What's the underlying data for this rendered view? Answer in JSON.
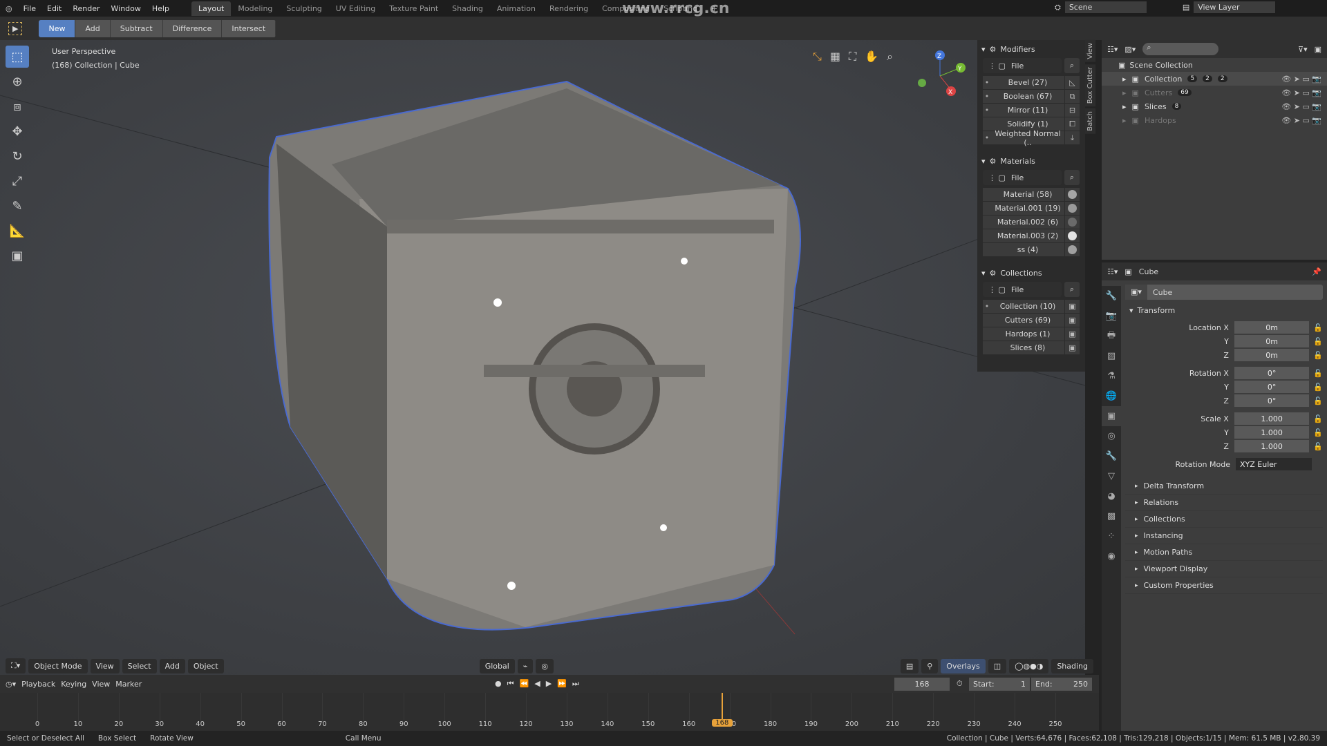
{
  "topbar": {
    "menus": [
      "File",
      "Edit",
      "Render",
      "Window",
      "Help"
    ],
    "workspaces": [
      "Layout",
      "Modeling",
      "Sculpting",
      "UV Editing",
      "Texture Paint",
      "Shading",
      "Animation",
      "Rendering",
      "Compositing",
      "Scripting"
    ],
    "active_workspace": "Layout",
    "add_tab": "+",
    "scene": "Scene",
    "view_layer": "View Layer"
  },
  "tool_header": {
    "modes": [
      "New",
      "Add",
      "Subtract",
      "Difference",
      "Intersect"
    ],
    "active_mode": "New"
  },
  "viewport": {
    "perspective": "User Perspective",
    "context": "(168) Collection | Cube",
    "axes": {
      "x": "X",
      "y": "Y",
      "z": "Z"
    },
    "header": {
      "mode": "Object Mode",
      "menus": [
        "View",
        "Select",
        "Add",
        "Object"
      ],
      "orientation": "Global",
      "overlays": "Overlays",
      "shading": "Shading"
    },
    "watermark": "www.rrcg.cn"
  },
  "npanel": {
    "tabs": [
      "View",
      "Box Cutter",
      "Batch"
    ],
    "modifiers": {
      "title": "Modifiers",
      "filter": "File",
      "items": [
        {
          "label": "Bevel (27)",
          "dot": true
        },
        {
          "label": "Boolean (67)",
          "dot": true
        },
        {
          "label": "Mirror (11)",
          "dot": true
        },
        {
          "label": "Solidify (1)",
          "dot": false
        },
        {
          "label": "Weighted Normal (..",
          "dot": true
        }
      ]
    },
    "materials": {
      "title": "Materials",
      "filter": "File",
      "items": [
        {
          "label": "Material (58)",
          "color": "#a6a6a6"
        },
        {
          "label": "Material.001 (19)",
          "color": "#9a9a9a"
        },
        {
          "label": "Material.002 (6)",
          "color": "#6a6a6a"
        },
        {
          "label": "Material.003 (2)",
          "color": "#e4e4e4"
        },
        {
          "label": "ss (4)",
          "color": "#a0a0a0"
        }
      ]
    },
    "collections": {
      "title": "Collections",
      "filter": "File",
      "items": [
        "Collection (10)",
        "Cutters (69)",
        "Hardops (1)",
        "Slices (8)"
      ]
    }
  },
  "outliner": {
    "root": "Scene Collection",
    "items": [
      {
        "name": "Collection",
        "badges": [
          "5",
          "2",
          "2"
        ],
        "dim": false
      },
      {
        "name": "Cutters",
        "badges": [
          "69"
        ],
        "dim": true
      },
      {
        "name": "Slices",
        "badges": [
          "8"
        ],
        "dim": false
      },
      {
        "name": "Hardops",
        "badges": [],
        "dim": true
      }
    ]
  },
  "properties": {
    "header": "Cube",
    "object_name": "Cube",
    "transform": {
      "title": "Transform",
      "rows": [
        {
          "label": "Location X",
          "value": "0m"
        },
        {
          "label": "Y",
          "value": "0m"
        },
        {
          "label": "Z",
          "value": "0m"
        },
        {
          "label": "Rotation X",
          "value": "0°"
        },
        {
          "label": "Y",
          "value": "0°"
        },
        {
          "label": "Z",
          "value": "0°"
        },
        {
          "label": "Scale X",
          "value": "1.000"
        },
        {
          "label": "Y",
          "value": "1.000"
        },
        {
          "label": "Z",
          "value": "1.000"
        }
      ],
      "rotation_mode_label": "Rotation Mode",
      "rotation_mode": "XYZ Euler"
    },
    "subpanels": [
      "Delta Transform",
      "Relations",
      "Collections",
      "Instancing",
      "Motion Paths",
      "Viewport Display",
      "Custom Properties"
    ]
  },
  "timeline": {
    "menus": [
      "Playback",
      "Keying",
      "View",
      "Marker"
    ],
    "current_frame": "168",
    "start_label": "Start:",
    "start": "1",
    "end_label": "End:",
    "end": "250",
    "ticks": [
      "0",
      "10",
      "20",
      "30",
      "40",
      "50",
      "60",
      "70",
      "80",
      "90",
      "100",
      "110",
      "120",
      "130",
      "140",
      "150",
      "160",
      "170",
      "180",
      "190",
      "200",
      "210",
      "220",
      "230",
      "240",
      "250"
    ],
    "playhead": 168
  },
  "status": {
    "hints": [
      "Select or Deselect All",
      "Box Select",
      "Rotate View",
      "Call Menu"
    ],
    "info": "Collection | Cube | Verts:64,676 | Faces:62,108 | Tris:129,218 | Objects:1/15 | Mem: 61.5 MB | v2.80.39"
  }
}
